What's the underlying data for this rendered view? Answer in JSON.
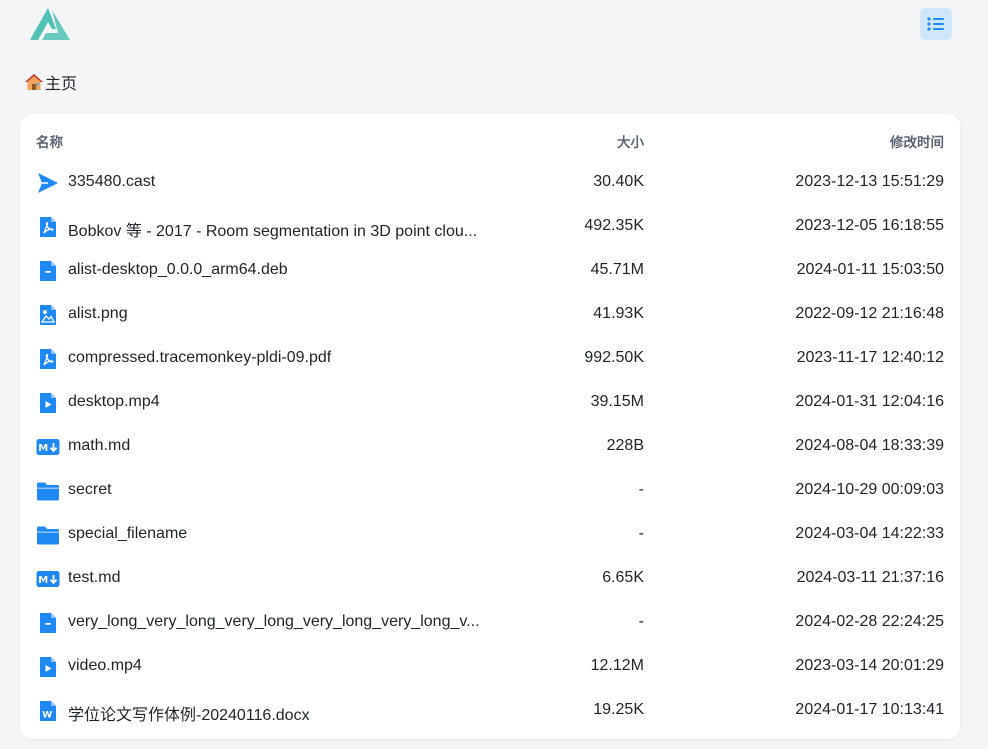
{
  "breadcrumb": {
    "home_label": "主页"
  },
  "columns": {
    "name": "名称",
    "size": "大小",
    "modified": "修改时间"
  },
  "colors": {
    "accent": "#1e88f5",
    "logo": "#4fc1b5",
    "toggle_bg": "#cfe6fb"
  },
  "files": [
    {
      "name": "335480.cast",
      "size": "30.40K",
      "modified": "2023-12-13 15:51:29",
      "icon": "cast-icon"
    },
    {
      "name": "Bobkov 等 - 2017 - Room segmentation in 3D point clou...",
      "size": "492.35K",
      "modified": "2023-12-05 16:18:55",
      "icon": "pdf-icon"
    },
    {
      "name": "alist-desktop_0.0.0_arm64.deb",
      "size": "45.71M",
      "modified": "2024-01-11 15:03:50",
      "icon": "file-icon"
    },
    {
      "name": "alist.png",
      "size": "41.93K",
      "modified": "2022-09-12 21:16:48",
      "icon": "image-icon"
    },
    {
      "name": "compressed.tracemonkey-pldi-09.pdf",
      "size": "992.50K",
      "modified": "2023-11-17 12:40:12",
      "icon": "pdf-icon"
    },
    {
      "name": "desktop.mp4",
      "size": "39.15M",
      "modified": "2024-01-31 12:04:16",
      "icon": "video-icon"
    },
    {
      "name": "math.md",
      "size": "228B",
      "modified": "2024-08-04 18:33:39",
      "icon": "markdown-icon"
    },
    {
      "name": "secret",
      "size": "-",
      "modified": "2024-10-29 00:09:03",
      "icon": "folder-icon"
    },
    {
      "name": "special_filename",
      "size": "-",
      "modified": "2024-03-04 14:22:33",
      "icon": "folder-icon"
    },
    {
      "name": "test.md",
      "size": "6.65K",
      "modified": "2024-03-11 21:37:16",
      "icon": "markdown-icon"
    },
    {
      "name": "very_long_very_long_very_long_very_long_very_long_v...",
      "size": "-",
      "modified": "2024-02-28 22:24:25",
      "icon": "file-icon"
    },
    {
      "name": "video.mp4",
      "size": "12.12M",
      "modified": "2023-03-14 20:01:29",
      "icon": "video-icon"
    },
    {
      "name": "学位论文写作体例-20240116.docx",
      "size": "19.25K",
      "modified": "2024-01-17 10:13:41",
      "icon": "word-icon"
    }
  ]
}
